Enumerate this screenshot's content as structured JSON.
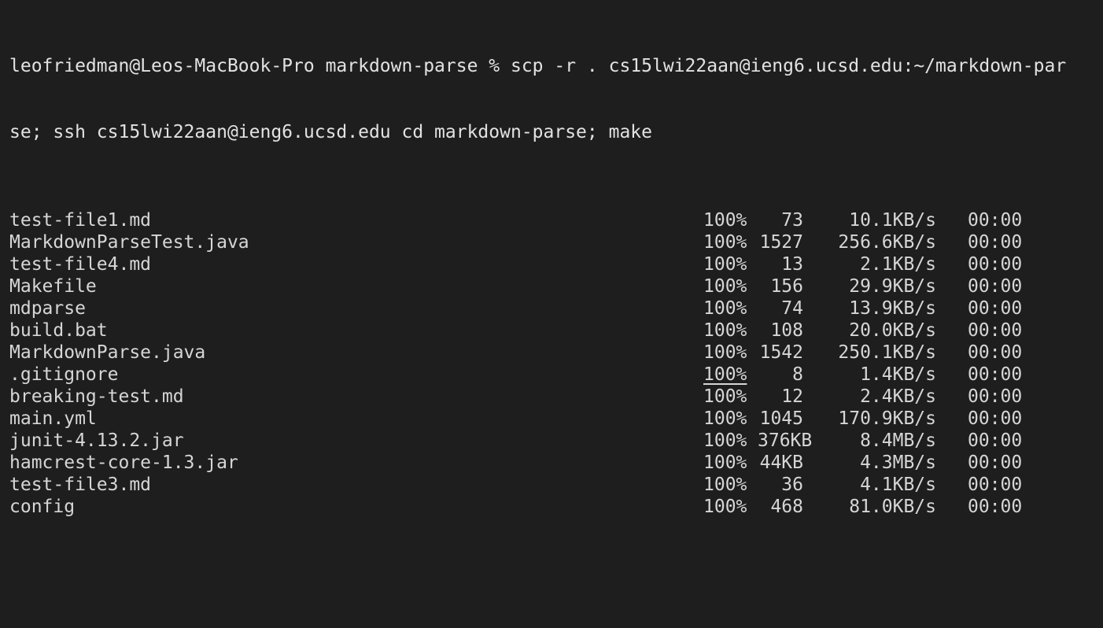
{
  "command": {
    "line1": "leofriedman@Leos-MacBook-Pro markdown-parse % scp -r . cs15lwi22aan@ieng6.ucsd.edu:~/markdown-par",
    "line2": "se; ssh cs15lwi22aan@ieng6.ucsd.edu cd markdown-parse; make"
  },
  "transfers": [
    {
      "name": "test-file1.md",
      "percent": "100%",
      "size": "73",
      "rate": "10.1KB/s",
      "eta": "00:00"
    },
    {
      "name": "MarkdownParseTest.java",
      "percent": "100%",
      "size": "1527",
      "rate": "256.6KB/s",
      "eta": "00:00"
    },
    {
      "name": "test-file4.md",
      "percent": "100%",
      "size": "13",
      "rate": "2.1KB/s",
      "eta": "00:00"
    },
    {
      "name": "Makefile",
      "percent": "100%",
      "size": "156",
      "rate": "29.9KB/s",
      "eta": "00:00"
    },
    {
      "name": "mdparse",
      "percent": "100%",
      "size": "74",
      "rate": "13.9KB/s",
      "eta": "00:00"
    },
    {
      "name": "build.bat",
      "percent": "100%",
      "size": "108",
      "rate": "20.0KB/s",
      "eta": "00:00"
    },
    {
      "name": "MarkdownParse.java",
      "percent": "100%",
      "size": "1542",
      "rate": "250.1KB/s",
      "eta": "00:00"
    },
    {
      "name": ".gitignore",
      "percent": "100%",
      "size": "8",
      "rate": "1.4KB/s",
      "eta": "00:00"
    },
    {
      "name": "breaking-test.md",
      "percent": "100%",
      "size": "12",
      "rate": "2.4KB/s",
      "eta": "00:00"
    },
    {
      "name": "main.yml",
      "percent": "100%",
      "size": "1045",
      "rate": "170.9KB/s",
      "eta": "00:00"
    },
    {
      "name": "junit-4.13.2.jar",
      "percent": "100%",
      "size": "376KB",
      "rate": "8.4MB/s",
      "eta": "00:00"
    },
    {
      "name": "hamcrest-core-1.3.jar",
      "percent": "100%",
      "size": "44KB",
      "rate": "4.3MB/s",
      "eta": "00:00"
    },
    {
      "name": "test-file3.md",
      "percent": "100%",
      "size": "36",
      "rate": "4.1KB/s",
      "eta": "00:00"
    },
    {
      "name": "config",
      "percent": "100%",
      "size": "468",
      "rate": "81.0KB/s",
      "eta": "00:00"
    }
  ],
  "colors": {
    "background": "#1e1e1e",
    "text": "#d6d6d6"
  }
}
